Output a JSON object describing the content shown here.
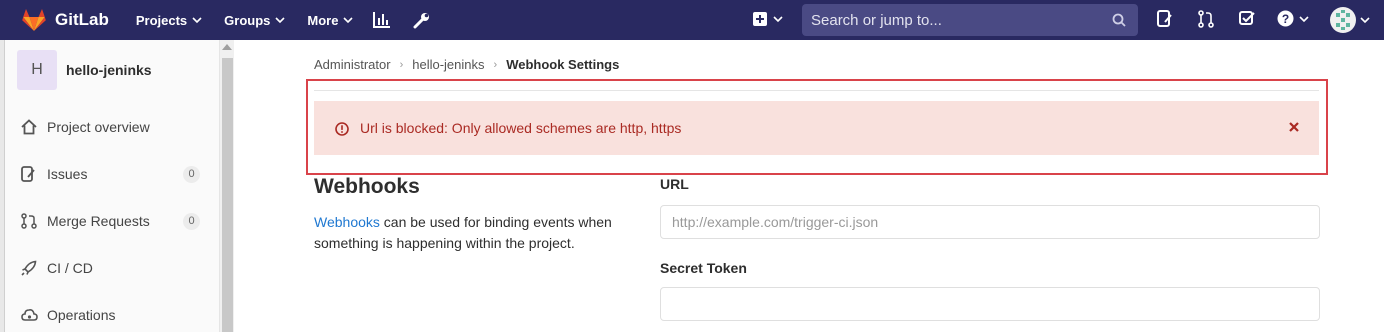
{
  "topbar": {
    "brand_name": "GitLab",
    "nav": [
      {
        "label": "Projects"
      },
      {
        "label": "Groups"
      },
      {
        "label": "More"
      }
    ],
    "search_placeholder": "Search or jump to...",
    "colors": {
      "bg": "#292961",
      "logo": "#fc6d26"
    }
  },
  "sidebar": {
    "project_initial": "H",
    "project_name": "hello-jeninks",
    "items": [
      {
        "label": "Project overview",
        "icon": "home-icon"
      },
      {
        "label": "Issues",
        "icon": "issues-icon",
        "count": "0"
      },
      {
        "label": "Merge Requests",
        "icon": "merge-request-icon",
        "count": "0"
      },
      {
        "label": "CI / CD",
        "icon": "rocket-icon"
      },
      {
        "label": "Operations",
        "icon": "cloud-gear-icon"
      }
    ]
  },
  "breadcrumb": {
    "items": [
      "Administrator",
      "hello-jeninks"
    ],
    "current": "Webhook Settings"
  },
  "alert": {
    "message": "Url is blocked: Only allowed schemes are http, https",
    "color": "#aa2a23"
  },
  "webhooks": {
    "title": "Webhooks",
    "desc_link": "Webhooks",
    "desc_rest": " can be used for binding events when something is happening within the project.",
    "url_label": "URL",
    "url_placeholder": "http://example.com/trigger-ci.json",
    "secret_label": "Secret Token",
    "secret_value": ""
  }
}
